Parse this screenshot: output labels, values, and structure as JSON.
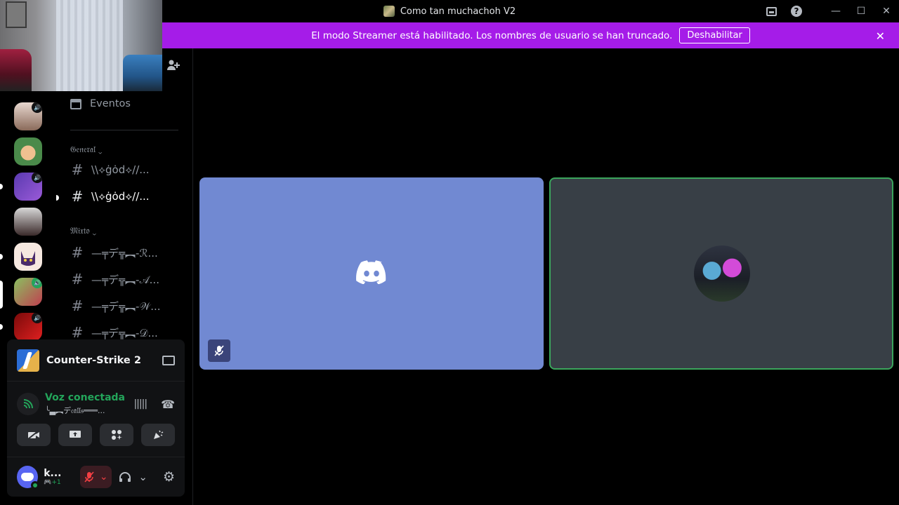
{
  "window": {
    "title": "Como tan muchachoh V2",
    "controls": {
      "inbox_icon": "inbox-icon",
      "help_label": "?",
      "minimize": "—",
      "maximize": "☐",
      "close": "✕"
    }
  },
  "banner": {
    "message": "El modo Streamer está habilitado. Los nombres de usuario se han truncado.",
    "button": "Deshabilitar",
    "close": "✕",
    "color": "#a51ce8"
  },
  "sidebar": {
    "events_label": "Eventos",
    "categories": [
      {
        "name": "𝔊𝔢𝔫𝔢𝔯𝔞𝔩 ⌄",
        "channels": [
          "\\\\⟡ġȯd⟡//...",
          "\\\\⟡ġȯd⟡//..."
        ]
      },
      {
        "name": "𝔐𝔦𝔵𝔱𝔬 ⌄",
        "channels": [
          "—╤デ╦︻-ℛ...",
          "—╤デ╦︻-𝒜...",
          "—╤デ╦︻-𝒲...",
          "—╤デ╦︻-𝒟..."
        ]
      }
    ],
    "hash": "#"
  },
  "panel": {
    "game": "Counter-Strike 2",
    "voice_status": "Voz conectada",
    "voice_channel": "╰▃︻デ𝔠𝔞𝔩𝔩𝔰═══...",
    "user": {
      "name": "k...",
      "status": "🎮+1"
    },
    "accent_green": "#23a55a"
  },
  "call": {
    "tile_a_color": "#7189d2",
    "tile_b_color": "#383f46",
    "speaking_border": "#3ba55c"
  }
}
